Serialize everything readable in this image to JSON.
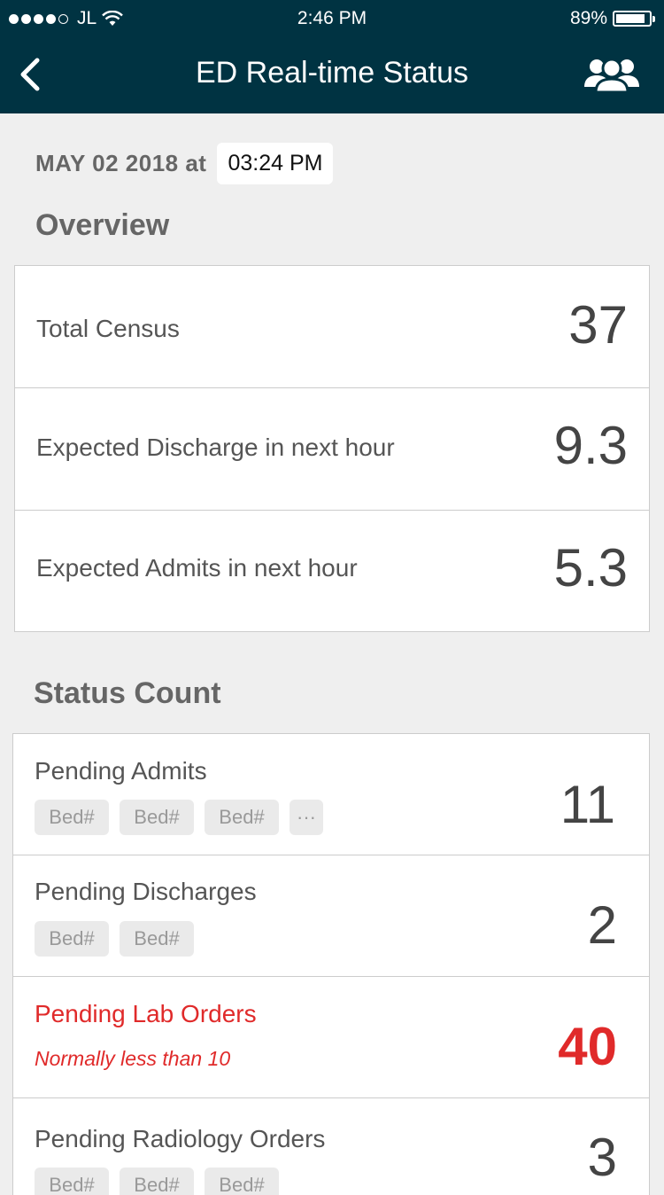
{
  "status_bar": {
    "carrier": "JL",
    "time": "2:46 PM",
    "battery": "89%",
    "battery_level": 0.89
  },
  "nav": {
    "title": "ED Real-time Status",
    "back_icon": "chevron-left-icon",
    "group_icon": "group-icon"
  },
  "date": {
    "date_label": "MAY 02 2018 at",
    "time_value": "03:24 PM"
  },
  "overview": {
    "title": "Overview",
    "rows": [
      {
        "label": "Total Census",
        "value": "37"
      },
      {
        "label": "Expected Discharge in next hour",
        "value": "9.3"
      },
      {
        "label": "Expected Admits in next hour",
        "value": "5.3"
      }
    ]
  },
  "status_count": {
    "title": "Status Count",
    "rows": [
      {
        "label": "Pending Admits",
        "value": "11",
        "chips": [
          "Bed#",
          "Bed#",
          "Bed#",
          "···"
        ]
      },
      {
        "label": "Pending Discharges",
        "value": "2",
        "chips": [
          "Bed#",
          "Bed#"
        ]
      },
      {
        "label": "Pending Lab Orders",
        "value": "40",
        "note": "Normally less than 10",
        "alert_color": "#e02a2a"
      },
      {
        "label": "Pending Radiology Orders",
        "value": "3",
        "chips": [
          "Bed#",
          "Bed#",
          "Bed#"
        ]
      }
    ]
  },
  "colors": {
    "header": "#003342",
    "background": "#efefef",
    "alert": "#e02a2a"
  }
}
